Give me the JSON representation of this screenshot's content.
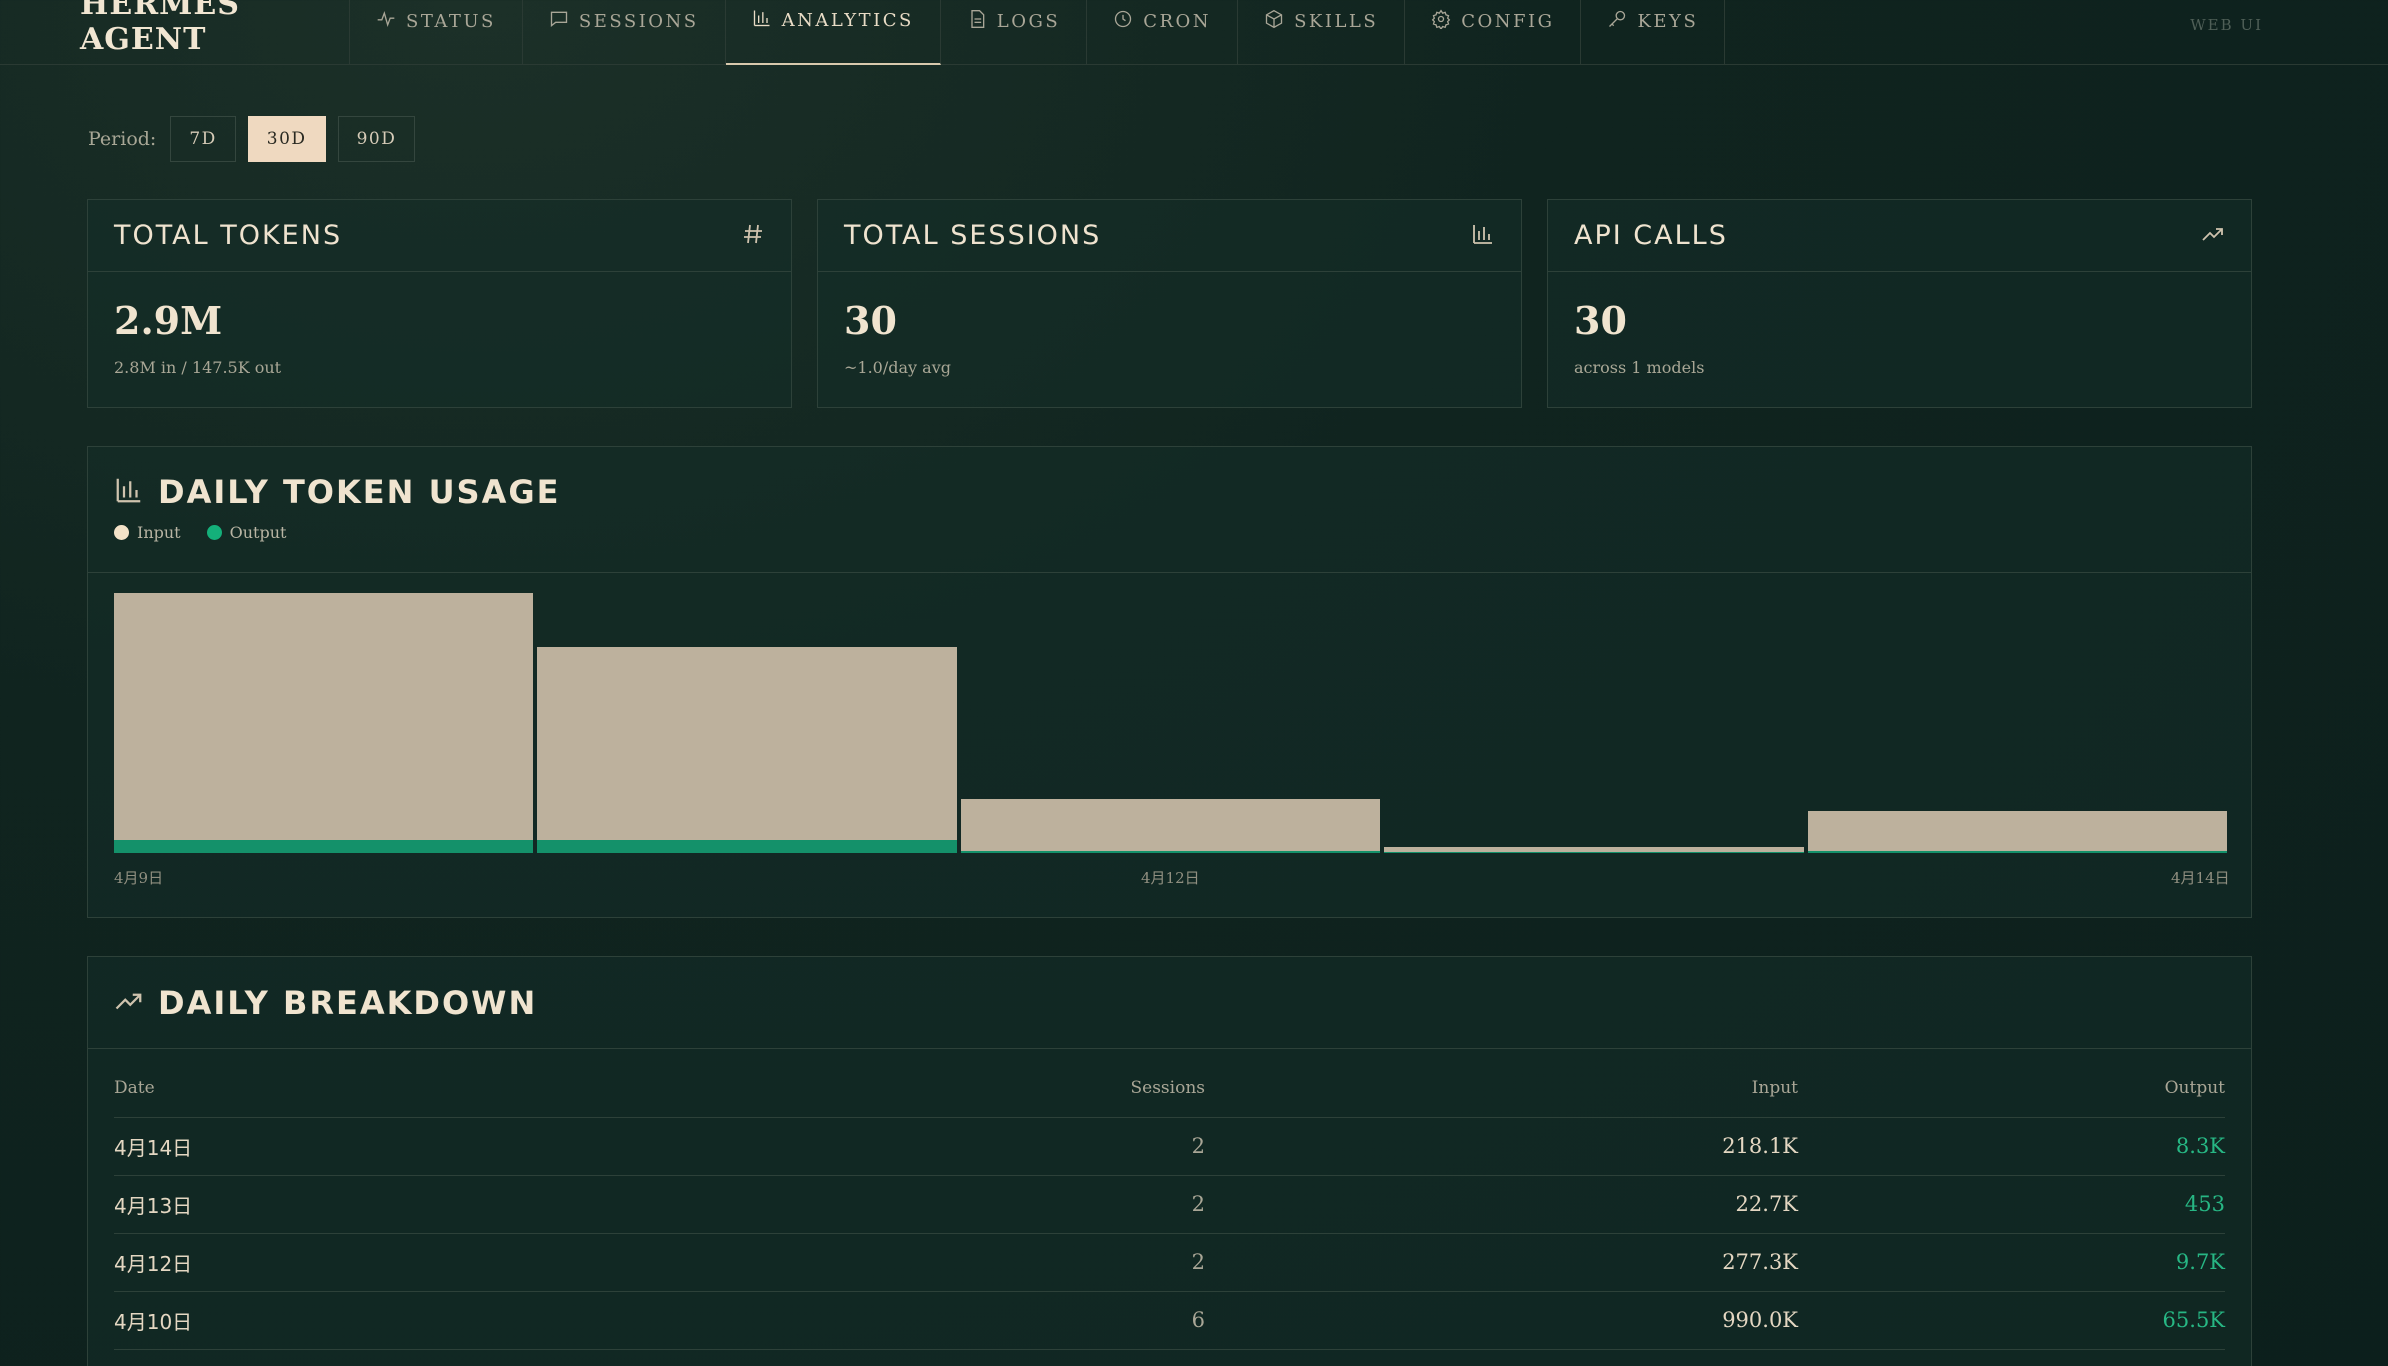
{
  "brand": "HERMES AGENT",
  "nav": {
    "tabs": [
      {
        "label": "STATUS",
        "icon": "activity-icon"
      },
      {
        "label": "SESSIONS",
        "icon": "message-icon"
      },
      {
        "label": "ANALYTICS",
        "icon": "bar-chart-icon",
        "active": true
      },
      {
        "label": "LOGS",
        "icon": "file-icon"
      },
      {
        "label": "CRON",
        "icon": "clock-icon"
      },
      {
        "label": "SKILLS",
        "icon": "package-icon"
      },
      {
        "label": "CONFIG",
        "icon": "gear-icon"
      },
      {
        "label": "KEYS",
        "icon": "key-icon"
      }
    ],
    "web_ui": "WEB UI"
  },
  "period": {
    "label": "Period:",
    "options": [
      "7D",
      "30D",
      "90D"
    ],
    "selected": "30D"
  },
  "stats": [
    {
      "title": "TOTAL TOKENS",
      "icon": "hash-icon",
      "value": "2.9M",
      "sub": "2.8M in / 147.5K out"
    },
    {
      "title": "TOTAL SESSIONS",
      "icon": "bar-chart-icon",
      "value": "30",
      "sub": "~1.0/day avg"
    },
    {
      "title": "API CALLS",
      "icon": "trending-up-icon",
      "value": "30",
      "sub": "across 1 models"
    }
  ],
  "daily_usage": {
    "title": "DAILY TOKEN USAGE",
    "legend": {
      "input": "Input",
      "output": "Output"
    }
  },
  "colors": {
    "input": "#bdb19d",
    "output": "#14916a",
    "accent": "#efd9c0"
  },
  "chart_data": {
    "type": "bar",
    "stacked": true,
    "categories": [
      "",
      "",
      "",
      "",
      ""
    ],
    "x_tick_labels": [
      "4月9日",
      "4月12日",
      "4月14日"
    ],
    "series": [
      {
        "name": "Input",
        "values": [
          1100000,
          860000,
          230000,
          25000,
          180000
        ]
      },
      {
        "name": "Output",
        "values": [
          60000,
          60000,
          9700,
          450,
          8300
        ]
      }
    ],
    "ylim": [
      0,
      1160000
    ]
  },
  "breakdown": {
    "title": "DAILY BREAKDOWN",
    "columns": [
      "Date",
      "Sessions",
      "Input",
      "Output"
    ],
    "rows": [
      {
        "date": "4月14日",
        "sessions": "2",
        "input": "218.1K",
        "output": "8.3K"
      },
      {
        "date": "4月13日",
        "sessions": "2",
        "input": "22.7K",
        "output": "453"
      },
      {
        "date": "4月12日",
        "sessions": "2",
        "input": "277.3K",
        "output": "9.7K"
      },
      {
        "date": "4月10日",
        "sessions": "6",
        "input": "990.0K",
        "output": "65.5K"
      }
    ]
  }
}
